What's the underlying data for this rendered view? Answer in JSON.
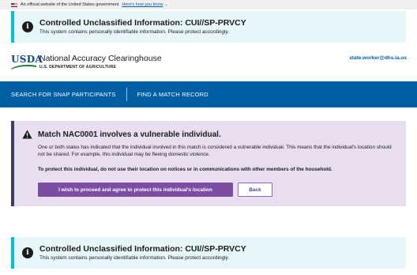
{
  "gov_banner": {
    "text": "An official website of the United States government",
    "link": "Here's how you know",
    "chevron": "⌄"
  },
  "cui_banner": {
    "icon": "info-icon",
    "icon_glyph": "i",
    "title": "Controlled Unclassified Information: CUI//SP-PRVCY",
    "body": "This system contains personally identifiable information. Please protect accordingly.",
    "accent_color": "#00bde3",
    "background": "#e7f6f8"
  },
  "header": {
    "logo_text": "USDA",
    "title": "National Accuracy Clearinghouse",
    "department": "U.S. DEPARTMENT OF AGRICULTURE",
    "user_email": "state.worker@dhs.ia.us"
  },
  "nav": {
    "items": [
      {
        "label": "SEARCH FOR SNAP PARTICIPANTS"
      },
      {
        "label": "FIND A MATCH RECORD"
      }
    ],
    "background": "#005ea2"
  },
  "alert": {
    "icon": "warning-icon",
    "title": "Match NAC0001 involves a vulnerable individual.",
    "body": "One or both states has indicated that the individual involved in this match is considered a vulnerable individual. This means that the individual's location should not be shared. For example, this individual may be fleeing domestic violence.",
    "emphasis": "To protect this individual, do not use their location on notices or in communications with other members of the household.",
    "confirm_label": "I wish to proceed and agree to protect this individual's location",
    "back_label": "Back",
    "background": "#e8def0",
    "button_color": "#7c4ea3"
  }
}
